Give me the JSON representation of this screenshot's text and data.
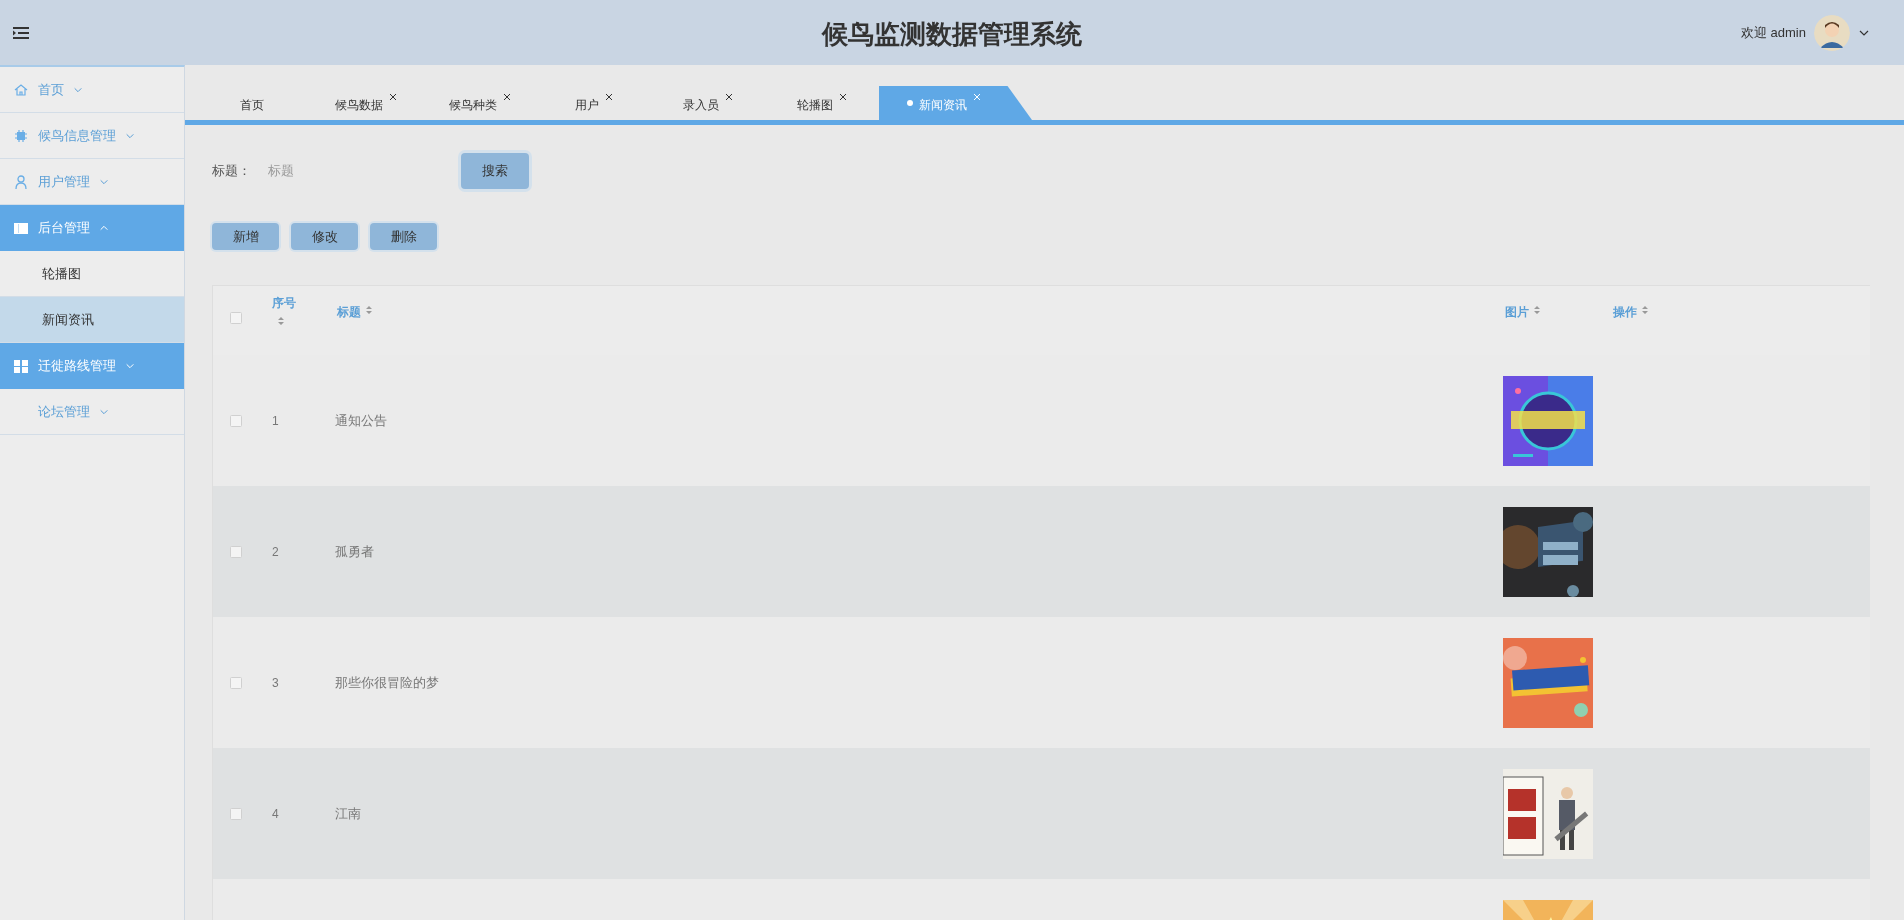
{
  "header": {
    "title": "候鸟监测数据管理系统",
    "welcome": "欢迎 admin"
  },
  "sidebar": {
    "items": [
      {
        "label": "首页",
        "expanded": false,
        "highlighted": false
      },
      {
        "label": "候鸟信息管理",
        "expanded": false,
        "highlighted": false
      },
      {
        "label": "用户管理",
        "expanded": false,
        "highlighted": false
      },
      {
        "label": "后台管理",
        "expanded": true,
        "highlighted": true,
        "children": [
          {
            "label": "轮播图",
            "selected": false
          },
          {
            "label": "新闻资讯",
            "selected": true
          }
        ]
      },
      {
        "label": "迁徙路线管理",
        "expanded": false,
        "highlighted": true
      },
      {
        "label": "论坛管理",
        "expanded": false,
        "highlighted": false
      }
    ]
  },
  "tabs": [
    {
      "label": "首页",
      "closable": false,
      "selected": false
    },
    {
      "label": "候鸟数据",
      "closable": true,
      "selected": false
    },
    {
      "label": "候鸟种类",
      "closable": true,
      "selected": false
    },
    {
      "label": "用户",
      "closable": true,
      "selected": false
    },
    {
      "label": "录入员",
      "closable": true,
      "selected": false
    },
    {
      "label": "轮播图",
      "closable": true,
      "selected": false
    },
    {
      "label": "新闻资讯",
      "closable": true,
      "selected": true
    }
  ],
  "search": {
    "label": "标题：",
    "placeholder": "标题",
    "button": "搜索"
  },
  "actions": [
    "新增",
    "修改",
    "删除"
  ],
  "table": {
    "select_all": {
      "checked": false
    },
    "columns": [
      {
        "label": "序号"
      },
      {
        "label": "标题"
      },
      {
        "label": "图片"
      },
      {
        "label": "操作"
      }
    ],
    "rows": [
      {
        "index": "1",
        "title": "通知公告",
        "checked": false,
        "image": {
          "kind": "picture"
        }
      },
      {
        "index": "2",
        "title": "孤勇者",
        "checked": false,
        "image": {
          "kind": "picture"
        }
      },
      {
        "index": "3",
        "title": "那些你很冒险的梦",
        "checked": false,
        "image": {
          "kind": "picture"
        }
      },
      {
        "index": "4",
        "title": "江南",
        "checked": false,
        "image": {
          "kind": "picture"
        }
      },
      {
        "image": {
          "kind": "picture"
        }
      }
    ]
  }
}
